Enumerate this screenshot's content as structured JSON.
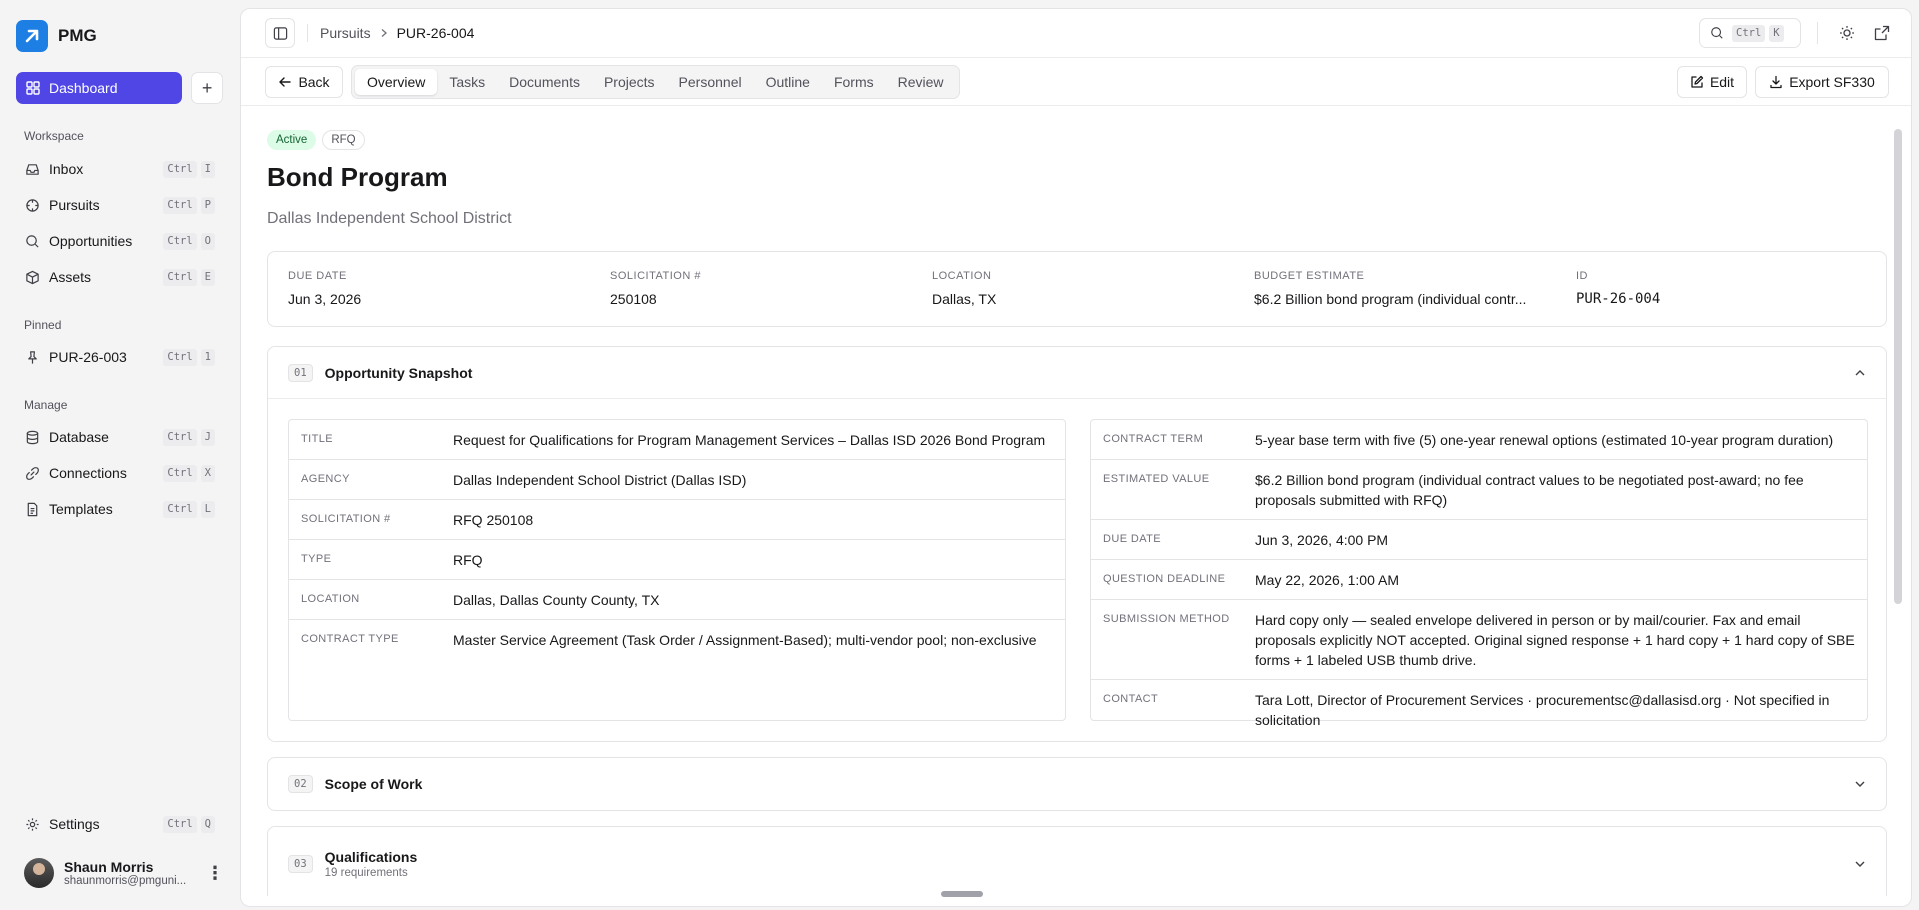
{
  "brand": {
    "name": "PMG",
    "color": "#1d7fe3"
  },
  "sidebar": {
    "dashboard_label": "Dashboard",
    "workspace_label": "Workspace",
    "workspace": [
      {
        "label": "Inbox",
        "keys": [
          "Ctrl",
          "I"
        ],
        "icon": "inbox-icon"
      },
      {
        "label": "Pursuits",
        "keys": [
          "Ctrl",
          "P"
        ],
        "icon": "target-icon"
      },
      {
        "label": "Opportunities",
        "keys": [
          "Ctrl",
          "O"
        ],
        "icon": "search-icon"
      },
      {
        "label": "Assets",
        "keys": [
          "Ctrl",
          "E"
        ],
        "icon": "box-icon"
      }
    ],
    "pinned_label": "Pinned",
    "pinned": [
      {
        "label": "PUR-26-003",
        "keys": [
          "Ctrl",
          "1"
        ],
        "icon": "pin-icon"
      }
    ],
    "manage_label": "Manage",
    "manage": [
      {
        "label": "Database",
        "keys": [
          "Ctrl",
          "J"
        ],
        "icon": "database-icon"
      },
      {
        "label": "Connections",
        "keys": [
          "Ctrl",
          "X"
        ],
        "icon": "link-icon"
      },
      {
        "label": "Templates",
        "keys": [
          "Ctrl",
          "L"
        ],
        "icon": "file-icon"
      }
    ],
    "settings": {
      "label": "Settings",
      "keys": [
        "Ctrl",
        "Q"
      ]
    },
    "user": {
      "name": "Shaun Morris",
      "email": "shaunmorris@pmguni..."
    }
  },
  "header": {
    "breadcrumb_parent": "Pursuits",
    "breadcrumb_current": "PUR-26-004",
    "search_keys": [
      "Ctrl",
      "K"
    ]
  },
  "toolbar": {
    "back_label": "Back",
    "tabs": [
      "Overview",
      "Tasks",
      "Documents",
      "Projects",
      "Personnel",
      "Outline",
      "Forms",
      "Review"
    ],
    "active_tab": "Overview",
    "edit_label": "Edit",
    "export_label": "Export SF330"
  },
  "pursuit": {
    "status": "Active",
    "type": "RFQ",
    "title": "Bond Program",
    "agency": "Dallas Independent School District",
    "summary": [
      {
        "label": "Due Date",
        "value": "Jun 3, 2026"
      },
      {
        "label": "Solicitation #",
        "value": "250108"
      },
      {
        "label": "Location",
        "value": "Dallas, TX"
      },
      {
        "label": "Budget Estimate",
        "value": "$6.2 Billion bond program (individual contr..."
      },
      {
        "label": "ID",
        "value": "PUR-26-004"
      }
    ]
  },
  "sections": {
    "snapshot": {
      "num": "01",
      "title": "Opportunity Snapshot",
      "left": [
        {
          "key": "Title",
          "value": "Request for Qualifications for Program Management Services – Dallas ISD 2026 Bond Program"
        },
        {
          "key": "Agency",
          "value": "Dallas Independent School District (Dallas ISD)"
        },
        {
          "key": "Solicitation #",
          "value": "RFQ 250108"
        },
        {
          "key": "Type",
          "value": "RFQ"
        },
        {
          "key": "Location",
          "value": "Dallas, Dallas County County, TX"
        },
        {
          "key": "Contract Type",
          "value": "Master Service Agreement (Task Order / Assignment-Based); multi-vendor pool; non-exclusive"
        }
      ],
      "right": [
        {
          "key": "Contract Term",
          "value": "5-year base term with five (5) one-year renewal options (estimated 10-year program duration)"
        },
        {
          "key": "Estimated Value",
          "value": "$6.2 Billion bond program (individual contract values to be negotiated post-award; no fee proposals submitted with RFQ)"
        },
        {
          "key": "Due Date",
          "value": "Jun 3, 2026, 4:00 PM"
        },
        {
          "key": "Question Deadline",
          "value": "May 22, 2026, 1:00 AM"
        },
        {
          "key": "Submission Method",
          "value": "Hard copy only — sealed envelope delivered in person or by mail/courier. Fax and email proposals explicitly NOT accepted. Original signed response + 1 hard copy + 1 hard copy of SBE forms + 1 labeled USB thumb drive."
        },
        {
          "key": "Contact",
          "value": "Tara Lott, Director of Procurement Services · procurementsc@dallasisd.org · Not specified in solicitation"
        }
      ]
    },
    "scope": {
      "num": "02",
      "title": "Scope of Work"
    },
    "qualifications": {
      "num": "03",
      "title": "Qualifications",
      "subtitle": "19 requirements"
    }
  },
  "colors": {
    "accent": "#4f46e5",
    "active_badge_bg": "#dcfce7",
    "active_badge_text": "#166534"
  }
}
